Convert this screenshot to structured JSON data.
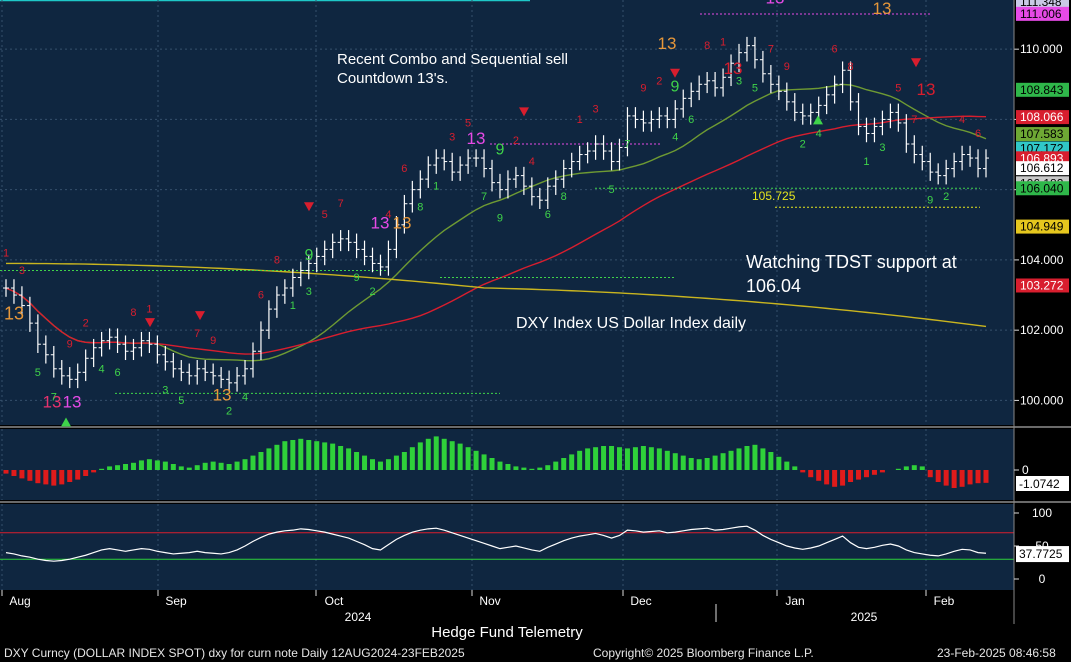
{
  "chart_data": {
    "type": "bar",
    "title": "DXY Index US Dollar Index daily",
    "annotations": {
      "sell_note": "Recent Combo and Sequential sell\nCountdown 13's.",
      "support_note": "Watching TDST support at\n106.04",
      "level_label": "105.725"
    },
    "x_tick_labels": [
      "Aug",
      "Sep",
      "Oct",
      "Nov",
      "Dec",
      "Jan",
      "Feb"
    ],
    "year_labels": [
      "2024",
      "2025"
    ],
    "y_ticks": [
      "100.000",
      "102.000",
      "104.000",
      "106.000",
      "108.000",
      "110.000"
    ],
    "ylim": [
      99.3,
      111.4
    ],
    "price_closes": [
      103.2,
      103.0,
      102.7,
      102.2,
      101.6,
      101.3,
      100.9,
      100.7,
      100.6,
      100.8,
      101.2,
      101.5,
      101.7,
      101.8,
      101.6,
      101.4,
      101.5,
      101.7,
      101.6,
      101.3,
      101.1,
      100.9,
      100.8,
      100.7,
      100.9,
      100.8,
      100.7,
      100.6,
      100.5,
      100.7,
      100.9,
      101.4,
      102.0,
      102.6,
      103.0,
      103.2,
      103.5,
      103.7,
      103.9,
      104.1,
      104.3,
      104.5,
      104.6,
      104.5,
      104.3,
      104.1,
      103.9,
      103.8,
      104.3,
      105.0,
      105.6,
      106.0,
      106.3,
      106.7,
      106.9,
      106.8,
      106.5,
      106.7,
      106.9,
      106.9,
      106.6,
      106.2,
      106.0,
      106.3,
      106.4,
      106.1,
      105.8,
      105.7,
      106.1,
      106.3,
      106.6,
      106.8,
      107.0,
      107.1,
      107.3,
      107.1,
      106.8,
      107.2,
      108.1,
      108.0,
      107.9,
      108.0,
      108.1,
      108.0,
      108.3,
      108.6,
      108.8,
      109.0,
      109.1,
      108.9,
      109.2,
      109.6,
      109.9,
      110.1,
      109.7,
      109.3,
      109.0,
      108.8,
      108.5,
      108.2,
      108.1,
      108.2,
      108.4,
      108.7,
      109.0,
      109.4,
      108.5,
      107.8,
      107.6,
      107.8,
      108.0,
      108.2,
      107.9,
      107.3,
      107.0,
      106.8,
      106.5,
      106.4,
      106.6,
      106.8,
      107.0,
      106.9,
      106.6,
      106.9
    ],
    "series": [
      {
        "name": "",
        "color": "#d81e2e"
      },
      {
        "name": "",
        "color": "#6e9a33"
      },
      {
        "name": "",
        "color": "#c9b51f"
      }
    ],
    "price_labels": [
      {
        "text": "111.348",
        "bg": "#c9c9e6",
        "fg": "#000000"
      },
      {
        "text": "111.006",
        "bg": "#e64ae6",
        "fg": "#000000"
      },
      {
        "text": "110.000",
        "bg": "",
        "fg": "#ffffff"
      },
      {
        "text": "108.843",
        "bg": "#2fb74a",
        "fg": "#000000"
      },
      {
        "text": "108.066",
        "bg": "#d81e2e",
        "fg": "#ffffff"
      },
      {
        "text": "107.583",
        "bg": "#6ea834",
        "fg": "#000000"
      },
      {
        "text": "107.172",
        "bg": "#30c7c7",
        "fg": "#000000"
      },
      {
        "text": "106.893",
        "bg": "#d81e2e",
        "fg": "#ffffff"
      },
      {
        "text": "106.612",
        "bg": "#ffffff",
        "fg": "#000000"
      },
      {
        "text": "106.182",
        "bg": "#c9c9c9",
        "fg": "#000000"
      },
      {
        "text": "106.040",
        "bg": "#2fb74a",
        "fg": "#000000"
      },
      {
        "text": "104.949",
        "bg": "#e6c71e",
        "fg": "#000000"
      },
      {
        "text": "103.272",
        "bg": "#d81e2e",
        "fg": "#ffffff"
      }
    ],
    "macd": {
      "y_ticks": [
        "0"
      ],
      "last_label": "-1.0742",
      "values": [
        -0.3,
        -0.5,
        -0.7,
        -0.9,
        -1.1,
        -1.2,
        -1.3,
        -1.2,
        -1.0,
        -0.8,
        -0.5,
        -0.2,
        0.1,
        0.3,
        0.4,
        0.5,
        0.6,
        0.8,
        0.9,
        0.8,
        0.7,
        0.5,
        0.3,
        0.2,
        0.4,
        0.6,
        0.7,
        0.6,
        0.5,
        0.7,
        0.9,
        1.2,
        1.5,
        1.8,
        2.1,
        2.4,
        2.5,
        2.6,
        2.5,
        2.4,
        2.3,
        2.2,
        2.0,
        1.8,
        1.5,
        1.2,
        0.9,
        0.7,
        0.9,
        1.2,
        1.5,
        1.9,
        2.3,
        2.6,
        2.8,
        2.6,
        2.4,
        2.2,
        1.9,
        1.6,
        1.3,
        1.0,
        0.7,
        0.5,
        0.3,
        0.2,
        0.1,
        0.2,
        0.4,
        0.7,
        1.0,
        1.3,
        1.6,
        1.8,
        1.9,
        2.0,
        2.0,
        1.9,
        1.8,
        1.9,
        2.0,
        1.9,
        1.8,
        1.6,
        1.4,
        1.2,
        1.0,
        0.9,
        1.0,
        1.2,
        1.4,
        1.6,
        1.8,
        2.0,
        2.1,
        1.8,
        1.5,
        1.1,
        0.7,
        0.3,
        -0.2,
        -0.6,
        -0.9,
        -1.2,
        -1.4,
        -1.3,
        -1.0,
        -0.8,
        -0.6,
        -0.4,
        -0.2,
        0.0,
        0.1,
        0.3,
        0.4,
        0.3,
        -0.6,
        -1.0,
        -1.3,
        -1.5,
        -1.4,
        -1.2,
        -1.1,
        -1.07
      ]
    },
    "rsi": {
      "y_ticks": [
        "100",
        "50",
        "0"
      ],
      "last_label": "37.7725",
      "values": [
        40,
        38,
        35,
        33,
        30,
        28,
        27,
        28,
        30,
        33,
        36,
        40,
        44,
        46,
        44,
        42,
        44,
        46,
        45,
        42,
        40,
        38,
        39,
        40,
        42,
        40,
        39,
        38,
        40,
        44,
        50,
        57,
        63,
        68,
        71,
        73,
        74,
        76,
        75,
        73,
        71,
        68,
        65,
        62,
        57,
        52,
        46,
        44,
        52,
        60,
        66,
        71,
        74,
        76,
        77,
        74,
        70,
        66,
        62,
        58,
        54,
        50,
        46,
        48,
        50,
        47,
        44,
        42,
        48,
        53,
        58,
        62,
        65,
        67,
        69,
        66,
        62,
        66,
        74,
        73,
        71,
        72,
        73,
        70,
        71,
        73,
        75,
        76,
        77,
        74,
        75,
        77,
        79,
        80,
        74,
        66,
        60,
        55,
        50,
        47,
        45,
        47,
        50,
        55,
        60,
        65,
        55,
        48,
        46,
        48,
        51,
        53,
        50,
        44,
        40,
        38,
        36,
        35,
        38,
        42,
        45,
        44,
        40,
        39
      ]
    }
  },
  "footer": {
    "left": "DXY Curncy (DOLLAR INDEX SPOT) dxy for curn note  Daily 12AUG2024-23FEB2025",
    "center_title": "Hedge Fund Telemetry",
    "copyright": "Copyright© 2025 Bloomberg Finance L.P.",
    "timestamp": "23-Feb-2025 08:46:58"
  }
}
